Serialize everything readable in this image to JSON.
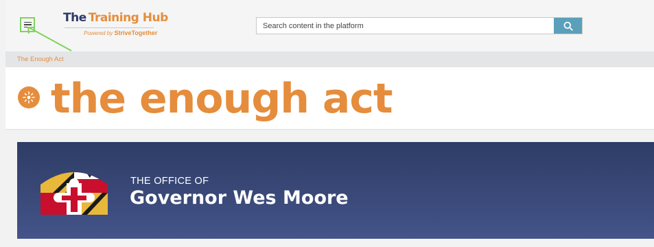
{
  "header": {
    "logo": {
      "the": "The",
      "hub": "Training Hub",
      "powered_by": "Powered by",
      "brand": "StriveTogether"
    },
    "search": {
      "placeholder": "Search content in the platform",
      "value": ""
    },
    "icons": {
      "menu": "hamburger-menu-icon",
      "search": "search-icon"
    }
  },
  "breadcrumb": {
    "current": "The Enough Act"
  },
  "main": {
    "title": "the enough act",
    "title_icon": "sparkle-icon"
  },
  "banner": {
    "small_text": "THE OFFICE OF",
    "big_text": "Governor Wes Moore",
    "seal_icon": "maryland-flag-seal-icon"
  },
  "colors": {
    "accent_orange": "#e58d3c",
    "navy": "#2d3a66",
    "search_button": "#5aa0ba",
    "highlight_green": "#7ed35c",
    "banner_top": "#2e3c66",
    "banner_bottom": "#44548a"
  }
}
